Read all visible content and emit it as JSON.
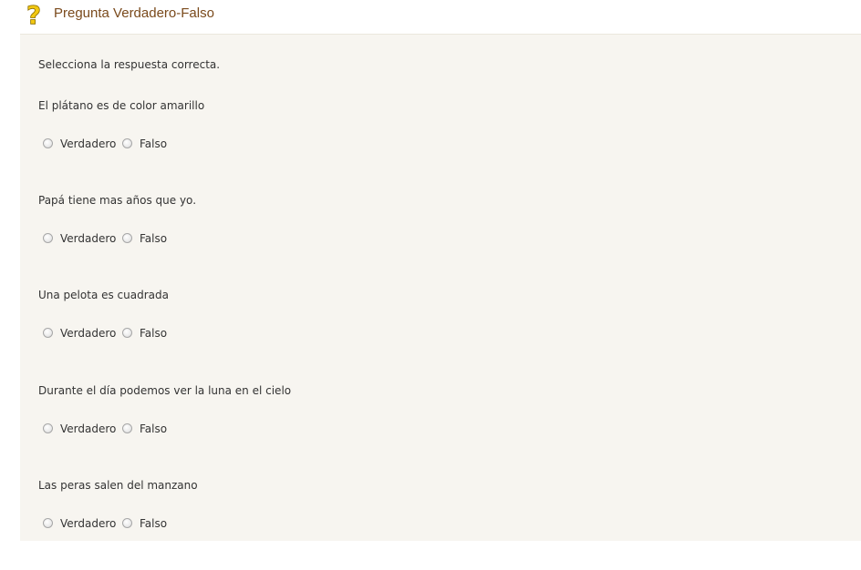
{
  "header": {
    "icon": "question-mark-icon",
    "title": "Pregunta Verdadero-Falso",
    "icon_color": "#e6b800",
    "title_color": "#7a4a1c"
  },
  "panel": {
    "background": "#f7f5f0",
    "instructions": "Selecciona la respuesta correcta."
  },
  "questions": [
    {
      "text": "El plátano es de color amarillo",
      "true_label": "Verdadero",
      "false_label": "Falso"
    },
    {
      "text": "Papá tiene mas años que yo.",
      "true_label": "Verdadero",
      "false_label": "Falso"
    },
    {
      "text": "Una pelota es cuadrada",
      "true_label": "Verdadero",
      "false_label": "Falso"
    },
    {
      "text": "Durante el día podemos ver la luna en el cielo",
      "true_label": "Verdadero",
      "false_label": "Falso"
    },
    {
      "text": "Las peras salen del manzano",
      "true_label": "Verdadero",
      "false_label": "Falso"
    }
  ]
}
